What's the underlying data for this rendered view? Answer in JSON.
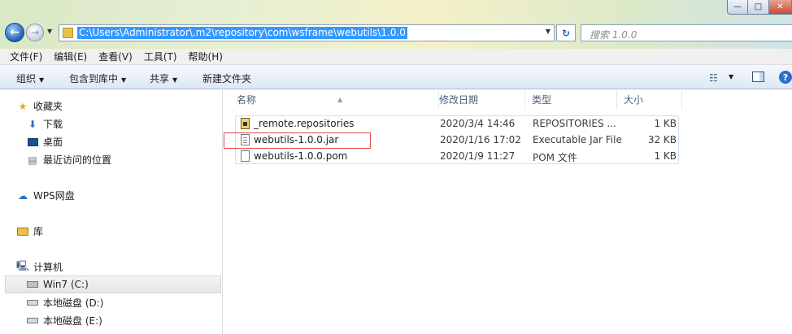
{
  "window": {
    "min_glyph": "—",
    "max_glyph": "□",
    "close_glyph": "✕"
  },
  "address": {
    "path": "C:\\Users\\Administrator\\.m2\\repository\\com\\wsframe\\webutils\\1.0.0",
    "search_placeholder": "搜索 1.0.0"
  },
  "menu": [
    "文件(F)",
    "编辑(E)",
    "查看(V)",
    "工具(T)",
    "帮助(H)"
  ],
  "toolbar": {
    "organize": "组织",
    "include_library": "包含到库中",
    "share": "共享",
    "new_folder": "新建文件夹"
  },
  "nav": {
    "favorites": "收藏夹",
    "downloads": "下载",
    "desktop": "桌面",
    "recent": "最近访问的位置",
    "wps": "WPS网盘",
    "libraries": "库",
    "computer": "计算机",
    "drive_c": "Win7 (C:)",
    "drive_d": "本地磁盘 (D:)",
    "drive_e": "本地磁盘 (E:)"
  },
  "columns": {
    "name": "名称",
    "date": "修改日期",
    "type": "类型",
    "size": "大小"
  },
  "files": [
    {
      "name": "_remote.repositories",
      "date": "2020/3/4 14:46",
      "type": "REPOSITORIES ...",
      "size": "1 KB",
      "icon": "repo-file-icon"
    },
    {
      "name": "webutils-1.0.0.jar",
      "date": "2020/1/16 17:02",
      "type": "Executable Jar File",
      "size": "32 KB",
      "icon": "jar-file-icon"
    },
    {
      "name": "webutils-1.0.0.pom",
      "date": "2020/1/9 11:27",
      "type": "POM 文件",
      "size": "1 KB",
      "icon": "blank-file-icon"
    }
  ],
  "colors": {
    "selection": "#3399ff",
    "highlight_box": "#e34a4a"
  }
}
